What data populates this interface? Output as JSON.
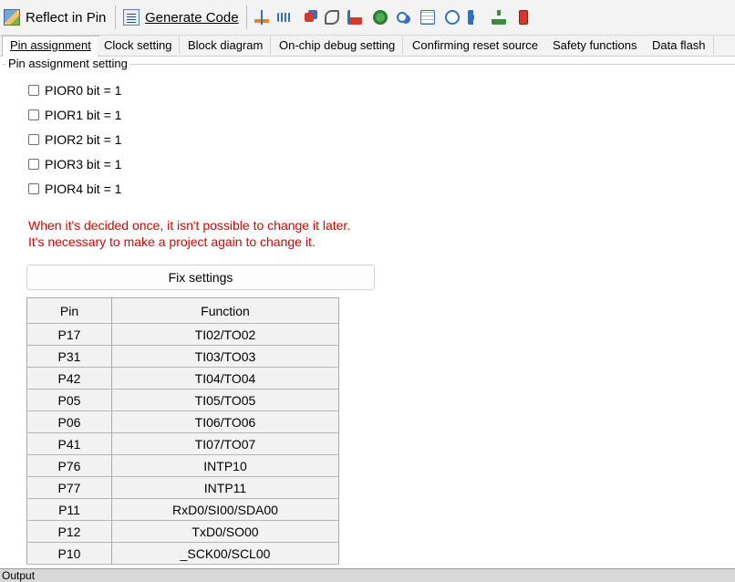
{
  "toolbar": {
    "reflect_label": "Reflect in Pin",
    "generate_label": "Generate Code",
    "mini_icons": [
      "tree-icon",
      "transfer-icon",
      "chip-icon",
      "wave-icon",
      "signal-icon",
      "clock-icon",
      "link-icon",
      "grid-icon",
      "timer-icon",
      "sound-icon",
      "network-icon",
      "battery-icon"
    ]
  },
  "tabs": [
    {
      "label": "Pin assignment",
      "active": true
    },
    {
      "label": "Clock setting"
    },
    {
      "label": "Block diagram"
    },
    {
      "label": "On-chip debug setting"
    },
    {
      "label": "Confirming reset source"
    },
    {
      "label": "Safety functions"
    },
    {
      "label": "Data flash"
    }
  ],
  "group": {
    "legend": "Pin assignment setting"
  },
  "checkboxes": [
    {
      "label": "PIOR0 bit = 1",
      "checked": false
    },
    {
      "label": "PIOR1 bit = 1",
      "checked": false
    },
    {
      "label": "PIOR2 bit = 1",
      "checked": false
    },
    {
      "label": "PIOR3 bit = 1",
      "checked": false
    },
    {
      "label": "PIOR4 bit = 1",
      "checked": false
    }
  ],
  "warning": {
    "line1": "When it's decided once, it isn't possible to change it later.",
    "line2": "It's necessary to make a project again to change it.",
    "color": "#e00000"
  },
  "fix_button": {
    "label": "Fix settings"
  },
  "table": {
    "headers": [
      "Pin",
      "Function"
    ],
    "rows": [
      [
        "P17",
        "TI02/TO02"
      ],
      [
        "P31",
        "TI03/TO03"
      ],
      [
        "P42",
        "TI04/TO04"
      ],
      [
        "P05",
        "TI05/TO05"
      ],
      [
        "P06",
        "TI06/TO06"
      ],
      [
        "P41",
        "TI07/TO07"
      ],
      [
        "P76",
        "INTP10"
      ],
      [
        "P77",
        "INTP11"
      ],
      [
        "P11",
        "RxD0/SI00/SDA00"
      ],
      [
        "P12",
        "TxD0/SO00"
      ],
      [
        "P10",
        "_SCK00/SCL00"
      ]
    ]
  },
  "output": {
    "label": "Output"
  }
}
